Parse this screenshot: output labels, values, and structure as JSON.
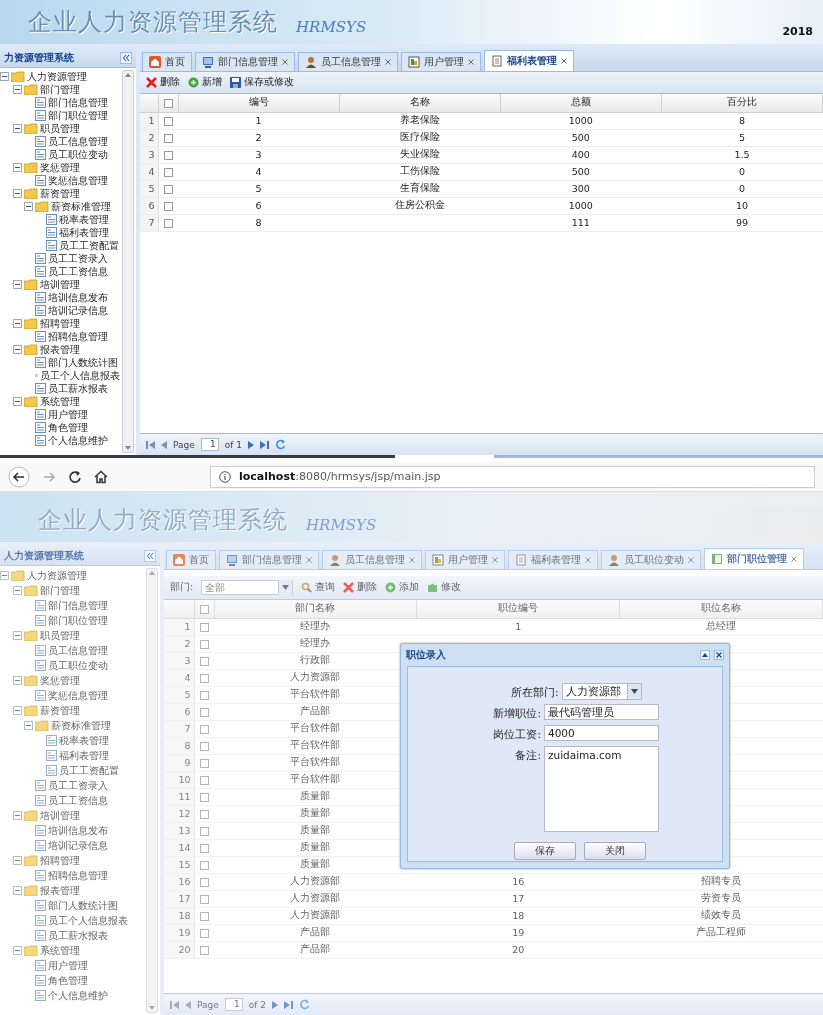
{
  "top_screen": {
    "banner": {
      "title": "企业人力资源管理系统",
      "subtitle": "HRMSYS",
      "date": "2018"
    },
    "sidebar": {
      "title": "力资源管理系统",
      "tree": [
        {
          "label": "人力资源管理",
          "expanded": true,
          "children": [
            {
              "label": "部门管理",
              "expanded": true,
              "children": [
                {
                  "label": "部门信息管理"
                },
                {
                  "label": "部门职位管理"
                }
              ]
            },
            {
              "label": "职员管理",
              "expanded": true,
              "children": [
                {
                  "label": "员工信息管理"
                },
                {
                  "label": "员工职位变动"
                }
              ]
            },
            {
              "label": "奖惩管理",
              "expanded": true,
              "children": [
                {
                  "label": "奖惩信息管理"
                }
              ]
            },
            {
              "label": "薪资管理",
              "expanded": true,
              "children": [
                {
                  "label": "薪资标准管理",
                  "expanded": true,
                  "children": [
                    {
                      "label": "税率表管理"
                    },
                    {
                      "label": "福利表管理"
                    },
                    {
                      "label": "员工工资配置"
                    }
                  ]
                },
                {
                  "label": "员工工资录入"
                },
                {
                  "label": "员工工资信息"
                }
              ]
            },
            {
              "label": "培训管理",
              "expanded": true,
              "children": [
                {
                  "label": "培训信息发布"
                },
                {
                  "label": "培训记录信息"
                }
              ]
            },
            {
              "label": "招聘管理",
              "expanded": true,
              "children": [
                {
                  "label": "招聘信息管理"
                }
              ]
            },
            {
              "label": "报表管理",
              "expanded": true,
              "children": [
                {
                  "label": "部门人数统计图"
                },
                {
                  "label": "员工个人信息报表"
                },
                {
                  "label": "员工薪水报表"
                }
              ]
            },
            {
              "label": "系统管理",
              "expanded": true,
              "children": [
                {
                  "label": "用户管理"
                },
                {
                  "label": "角色管理"
                },
                {
                  "label": "个人信息维护"
                }
              ]
            }
          ]
        }
      ]
    },
    "tabs": [
      {
        "label": "首页",
        "kind": "home",
        "selected": false
      },
      {
        "label": "部门信息管理",
        "kind": "monitor",
        "selected": false
      },
      {
        "label": "员工信息管理",
        "kind": "user",
        "selected": false
      },
      {
        "label": "用户管理",
        "kind": "chart",
        "selected": false
      },
      {
        "label": "福利表管理",
        "kind": "doc",
        "selected": true
      }
    ],
    "toolbar": [
      {
        "kind": "delete",
        "label": "删除"
      },
      {
        "kind": "add",
        "label": "新增"
      },
      {
        "kind": "save",
        "label": "保存或修改"
      }
    ],
    "table": {
      "columns": [
        "编号",
        "名称",
        "总额",
        "百分比"
      ],
      "all_checked": false,
      "rows": [
        {
          "index": "1",
          "checked": false,
          "cells": [
            "1",
            "养老保险",
            "1000",
            "8"
          ]
        },
        {
          "index": "2",
          "checked": false,
          "cells": [
            "2",
            "医疗保险",
            "500",
            "5"
          ]
        },
        {
          "index": "3",
          "checked": false,
          "cells": [
            "3",
            "失业保险",
            "400",
            "1.5"
          ]
        },
        {
          "index": "4",
          "checked": false,
          "cells": [
            "4",
            "工伤保险",
            "500",
            "0"
          ]
        },
        {
          "index": "5",
          "checked": false,
          "cells": [
            "5",
            "生育保险",
            "300",
            "0"
          ]
        },
        {
          "index": "6",
          "checked": false,
          "cells": [
            "6",
            "住房公积金",
            "1000",
            "10"
          ]
        },
        {
          "index": "7",
          "checked": false,
          "cells": [
            "8",
            "",
            "111",
            "99"
          ]
        }
      ]
    },
    "pager": {
      "label": "Page",
      "page": "1",
      "total": "of 1"
    }
  },
  "browser_bar": {
    "url": "**localhost**:8080/hrmsys/jsp/main.jsp"
  },
  "bottom_screen": {
    "banner": {
      "title": "企业人力资源管理系统",
      "subtitle": "HRMSYS"
    },
    "sidebar": {
      "title": "人力资源管理系统",
      "tree": [
        {
          "label": "人力资源管理",
          "expanded": true,
          "children": [
            {
              "label": "部门管理",
              "expanded": true,
              "children": [
                {
                  "label": "部门信息管理"
                },
                {
                  "label": "部门职位管理"
                }
              ]
            },
            {
              "label": "职员管理",
              "expanded": true,
              "children": [
                {
                  "label": "员工信息管理"
                },
                {
                  "label": "员工职位变动"
                }
              ]
            },
            {
              "label": "奖惩管理",
              "expanded": true,
              "children": [
                {
                  "label": "奖惩信息管理"
                }
              ]
            },
            {
              "label": "薪资管理",
              "expanded": true,
              "children": [
                {
                  "label": "薪资标准管理",
                  "expanded": true,
                  "children": [
                    {
                      "label": "税率表管理"
                    },
                    {
                      "label": "福利表管理"
                    },
                    {
                      "label": "员工工资配置"
                    }
                  ]
                },
                {
                  "label": "员工工资录入"
                },
                {
                  "label": "员工工资信息"
                }
              ]
            },
            {
              "label": "培训管理",
              "expanded": true,
              "children": [
                {
                  "label": "培训信息发布"
                },
                {
                  "label": "培训记录信息"
                }
              ]
            },
            {
              "label": "招聘管理",
              "expanded": true,
              "children": [
                {
                  "label": "招聘信息管理"
                }
              ]
            },
            {
              "label": "报表管理",
              "expanded": true,
              "children": [
                {
                  "label": "部门人数统计图"
                },
                {
                  "label": "员工个人信息报表"
                },
                {
                  "label": "员工薪水报表"
                }
              ]
            },
            {
              "label": "系统管理",
              "expanded": true,
              "children": [
                {
                  "label": "用户管理"
                },
                {
                  "label": "角色管理"
                },
                {
                  "label": "个人信息维护"
                }
              ]
            }
          ]
        }
      ]
    },
    "tabs": [
      {
        "label": "首页",
        "kind": "home",
        "selected": false
      },
      {
        "label": "部门信息管理",
        "kind": "monitor",
        "selected": false
      },
      {
        "label": "员工信息管理",
        "kind": "user",
        "selected": false
      },
      {
        "label": "用户管理",
        "kind": "chart",
        "selected": false
      },
      {
        "label": "福利表管理",
        "kind": "doc",
        "selected": false
      },
      {
        "label": "员工职位变动",
        "kind": "user",
        "selected": false
      },
      {
        "label": "部门职位管理",
        "kind": "book",
        "selected": true
      }
    ],
    "filter": {
      "label": "部门:",
      "placeholder": "全部"
    },
    "toolbar": [
      {
        "kind": "search",
        "label": "查询"
      },
      {
        "kind": "delete",
        "label": "删除"
      },
      {
        "kind": "add",
        "label": "添加"
      },
      {
        "kind": "edit",
        "label": "修改"
      }
    ],
    "table": {
      "columns": [
        "部门名称",
        "职位编号",
        "职位名称"
      ],
      "all_checked": false,
      "rows": [
        {
          "index": "1",
          "checked": false,
          "cells": [
            "经理办",
            "1",
            "总经理"
          ]
        },
        {
          "index": "2",
          "checked": false,
          "cells": [
            "经理办"
          ]
        },
        {
          "index": "3",
          "checked": false,
          "cells": [
            "行政部"
          ]
        },
        {
          "index": "4",
          "checked": false,
          "cells": [
            "人力资源部"
          ]
        },
        {
          "index": "5",
          "checked": false,
          "cells": [
            "平台软件部"
          ]
        },
        {
          "index": "6",
          "checked": false,
          "cells": [
            "产品部"
          ]
        },
        {
          "index": "7",
          "checked": false,
          "cells": [
            "平台软件部"
          ]
        },
        {
          "index": "8",
          "checked": false,
          "cells": [
            "平台软件部"
          ]
        },
        {
          "index": "9",
          "checked": false,
          "cells": [
            "平台软件部"
          ]
        },
        {
          "index": "10",
          "checked": false,
          "cells": [
            "平台软件部"
          ]
        },
        {
          "index": "11",
          "checked": false,
          "cells": [
            "质量部"
          ]
        },
        {
          "index": "12",
          "checked": false,
          "cells": [
            "质量部"
          ]
        },
        {
          "index": "13",
          "checked": false,
          "cells": [
            "质量部"
          ]
        },
        {
          "index": "14",
          "checked": false,
          "cells": [
            "质量部"
          ]
        },
        {
          "index": "15",
          "checked": false,
          "cells": [
            "质量部"
          ]
        },
        {
          "index": "16",
          "checked": false,
          "cells": [
            "人力资源部",
            "16",
            "招聘专员"
          ]
        },
        {
          "index": "17",
          "checked": false,
          "cells": [
            "人力资源部",
            "17",
            "劳资专员"
          ]
        },
        {
          "index": "18",
          "checked": false,
          "cells": [
            "人力资源部",
            "18",
            "绩效专员"
          ]
        },
        {
          "index": "19",
          "checked": false,
          "cells": [
            "产品部",
            "19",
            "产品工程师"
          ]
        },
        {
          "index": "20",
          "checked": false,
          "cells": [
            "产品部",
            "20"
          ]
        }
      ]
    },
    "pager": {
      "label": "Page",
      "page": "1",
      "total": "of 2"
    },
    "dialog": {
      "title": "职位录入",
      "fields": [
        {
          "kind": "select",
          "label": "所在部门:",
          "value": "人力资源部"
        },
        {
          "kind": "text",
          "label": "新增职位:",
          "value": "最代码管理员"
        },
        {
          "kind": "text",
          "label": "岗位工资:",
          "value": "4000"
        },
        {
          "kind": "textarea",
          "label": "备注:",
          "value": "zuidaima.com"
        }
      ],
      "buttons": [
        "保存",
        "关闭"
      ]
    }
  }
}
